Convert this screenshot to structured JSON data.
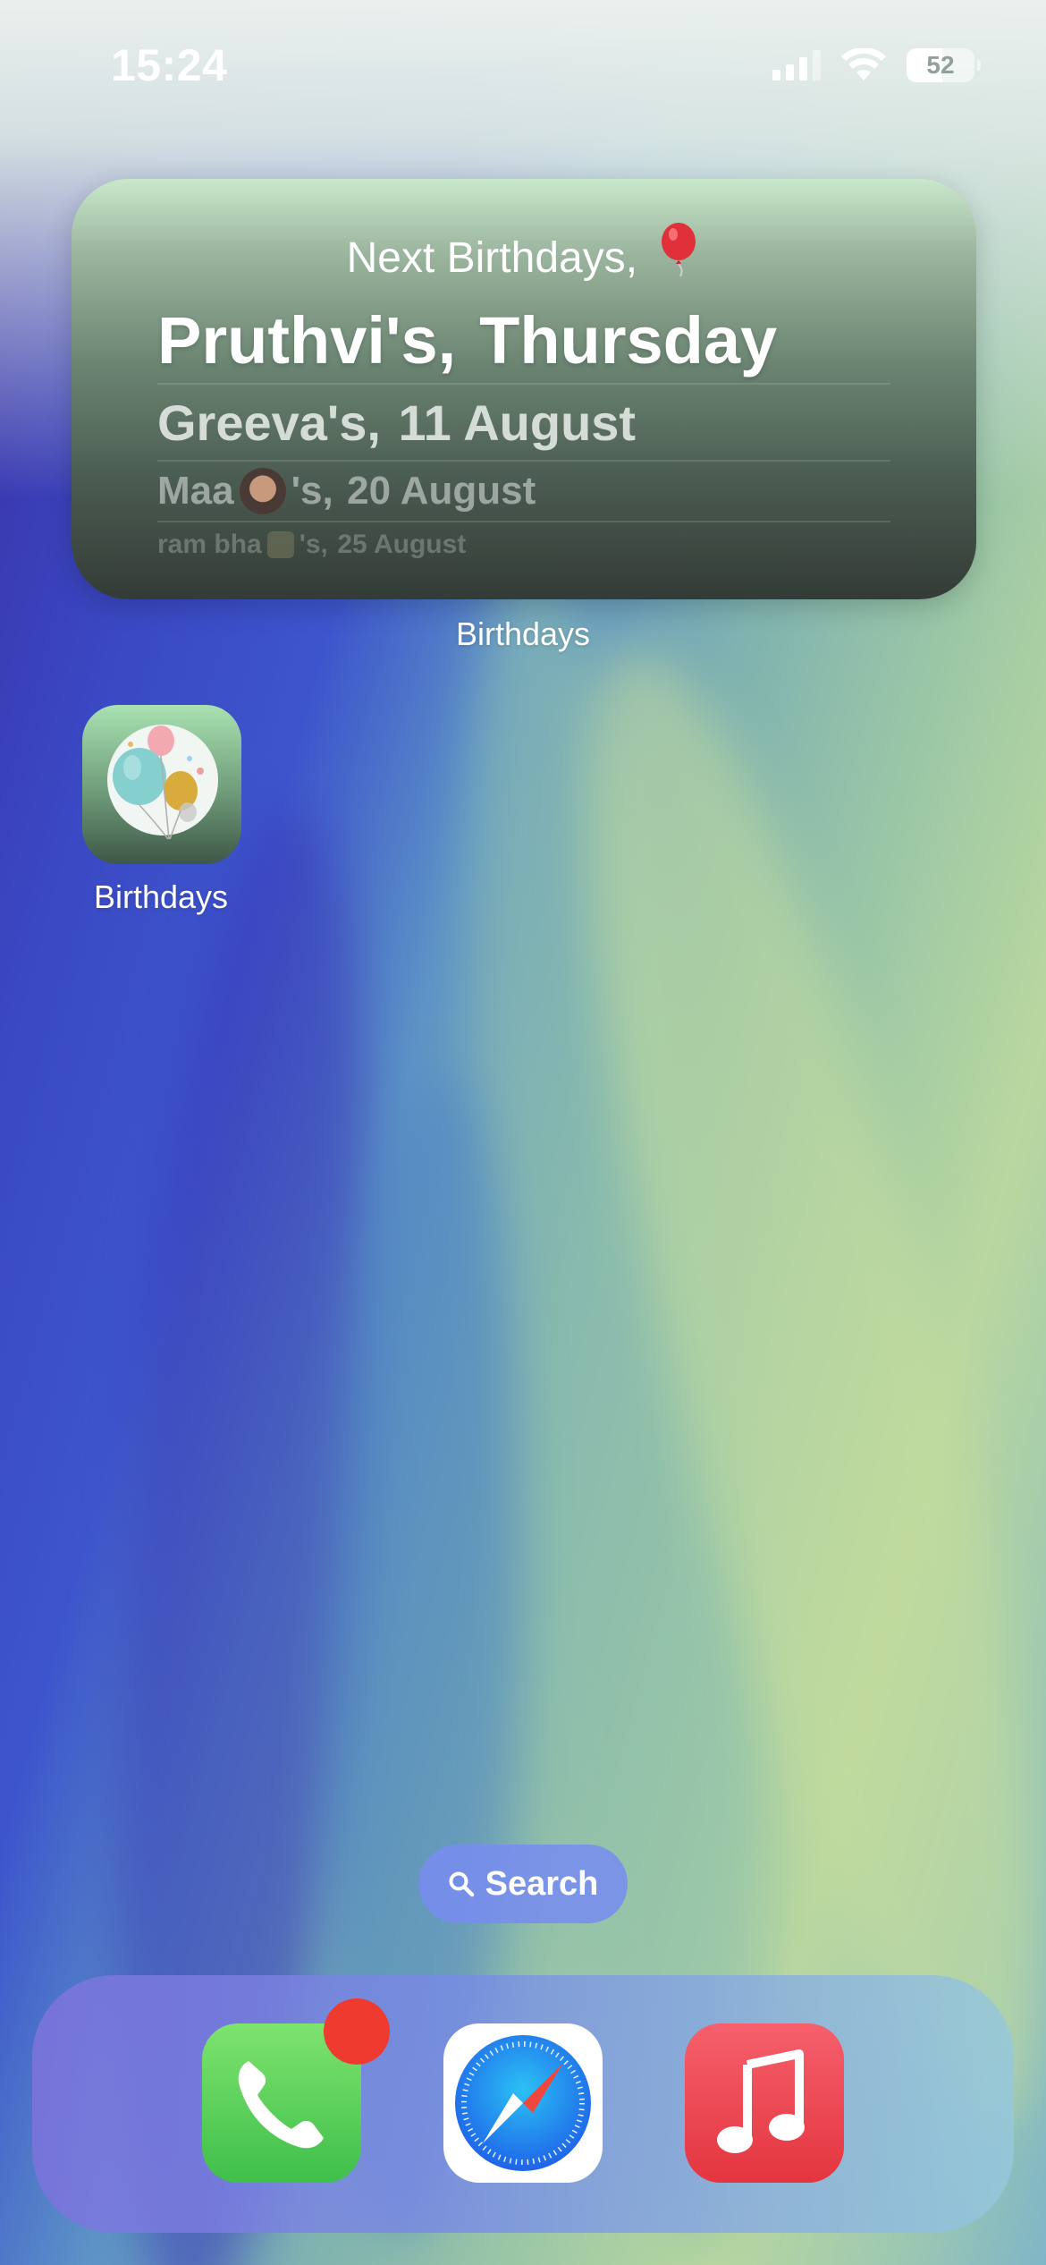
{
  "status_bar": {
    "time": "15:24",
    "battery_percent": "52",
    "battery_level": 0.52,
    "signal_bars_active": 3,
    "wifi": true
  },
  "widget": {
    "title": "Next Birthdays,",
    "title_emoji": "balloon-icon",
    "rows": [
      {
        "name": "Pruthvi's,",
        "date": "Thursday"
      },
      {
        "name": "Greeva's,",
        "date": "11 August"
      },
      {
        "name_prefix": "Maa",
        "name_emoji": "woman-face-icon",
        "name_suffix": "'s,",
        "date": "20 August"
      },
      {
        "name_prefix": "ram bha",
        "name_emoji": "person-icon",
        "name_suffix": "'s,",
        "date": "25 August"
      }
    ],
    "label": "Birthdays"
  },
  "home_apps": [
    {
      "label": "Birthdays",
      "icon": "balloons-icon"
    }
  ],
  "search": {
    "label": "Search",
    "icon": "magnifier-icon"
  },
  "dock": {
    "apps": [
      {
        "name": "Phone",
        "icon": "phone-icon",
        "has_badge": true
      },
      {
        "name": "Safari",
        "icon": "compass-icon"
      },
      {
        "name": "Music",
        "icon": "music-note-icon"
      }
    ]
  },
  "colors": {
    "badge": "#ef3b2f",
    "widget_top": "#c9e8cb",
    "widget_bottom": "#343b36",
    "search_pill": "#7b8cf0"
  }
}
